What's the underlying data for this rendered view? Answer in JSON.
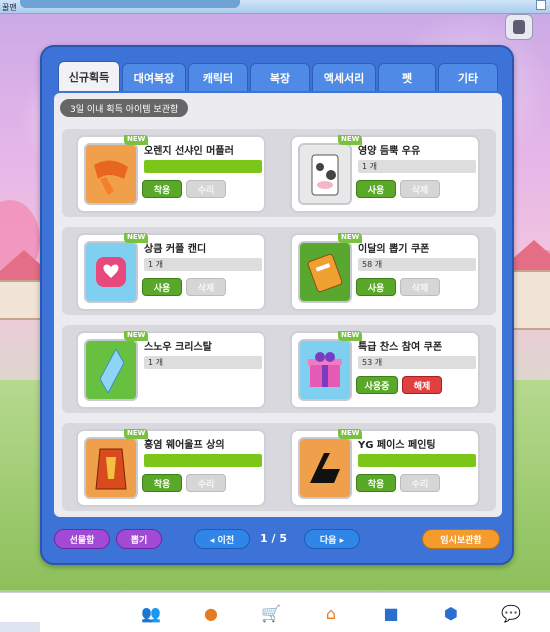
{
  "top": {
    "label": "꿀맨"
  },
  "tabs": [
    {
      "label": "신규획득",
      "active": true
    },
    {
      "label": "대여복장"
    },
    {
      "label": "캐릭터"
    },
    {
      "label": "복장"
    },
    {
      "label": "액세서리"
    },
    {
      "label": "펫"
    },
    {
      "label": "기타"
    }
  ],
  "notice": "3일 이내 획득 아이템 보관함",
  "items": [
    {
      "name": "오렌지 선샤인 머플러",
      "info": "",
      "new_tag": "NEW",
      "btn1": "착용",
      "btn2": "수리",
      "icon": "muffler-icon",
      "color": "#f0a04a"
    },
    {
      "name": "영양 듬뿍 우유",
      "info": "1 개",
      "new_tag": "NEW",
      "btn1": "사용",
      "btn2": "삭제",
      "icon": "milk-icon",
      "color": "#e8e8e8"
    },
    {
      "name": "상큼 커플 캔디",
      "info": "1 개",
      "new_tag": "NEW",
      "btn1": "사용",
      "btn2": "삭제",
      "icon": "candy-icon",
      "color": "#7fd0f0"
    },
    {
      "name": "이달의 뽑기 쿠폰",
      "info": "58 개",
      "new_tag": "NEW",
      "btn1": "사용",
      "btn2": "삭제",
      "icon": "coupon-icon",
      "color": "#58a830"
    },
    {
      "name": "스노우 크리스탈",
      "info": "1 개",
      "new_tag": "NEW",
      "btn1": "",
      "btn2": "",
      "icon": "crystal-icon",
      "color": "#68c040"
    },
    {
      "name": "특급 찬스 참여 쿠폰",
      "info": "53 개",
      "new_tag": "NEW",
      "btn1": "사용중",
      "btn2": "해제",
      "icon": "gift-box-icon",
      "color": "#7fd0f0"
    },
    {
      "name": "홍염 웨어울프 상의",
      "info": "",
      "new_tag": "NEW",
      "btn1": "착용",
      "btn2": "수리",
      "icon": "werewolf-top-icon",
      "color": "#f0a04a"
    },
    {
      "name": "YG 페이스 페인팅",
      "info": "",
      "new_tag": "NEW",
      "btn1": "착용",
      "btn2": "수리",
      "icon": "face-paint-icon",
      "color": "#f0a04a"
    }
  ],
  "bottom": {
    "gift_box": "선물함",
    "draw": "뽑기",
    "prev": "◂ 이전",
    "page": "1 / 5",
    "next": "다음 ▸",
    "temp_storage": "임시보관함"
  }
}
